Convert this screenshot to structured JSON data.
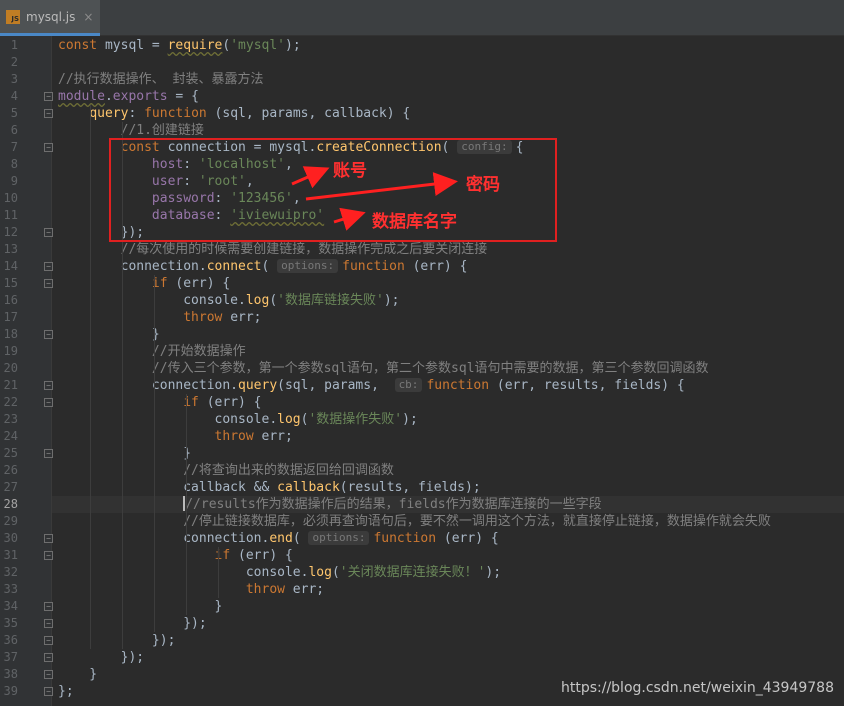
{
  "tab": {
    "icon_label": "JS",
    "title": "mysql.js",
    "close": "×"
  },
  "lines": [
    {
      "n": "1",
      "html": "<span class=\"kw\">const</span> mysql = <span class=\"fn wavy\">require</span>(<span class=\"str\">'mysql'</span>);"
    },
    {
      "n": "2",
      "html": ""
    },
    {
      "n": "3",
      "html": "<span class=\"cmt\">//执行数据操作、 封装、暴露方法</span>"
    },
    {
      "n": "4",
      "html": "<span class=\"prop wavy\">module</span>.<span class=\"prop\">exports</span> = {"
    },
    {
      "n": "5",
      "html": "    <span class=\"fn\">query</span>: <span class=\"kw\">function</span> (sql, params, callback) {"
    },
    {
      "n": "6",
      "html": "        <span class=\"cmt\">//1.创建链接</span>"
    },
    {
      "n": "7",
      "html": "        <span class=\"kw\">const</span> connection = mysql.<span class=\"fn\">createConnection</span>( <span class=\"hint\">config:</span>{"
    },
    {
      "n": "8",
      "html": "            <span class=\"prop\">host</span>: <span class=\"str\">'localhost'</span>,"
    },
    {
      "n": "9",
      "html": "            <span class=\"prop\">user</span>: <span class=\"str\">'root'</span>,"
    },
    {
      "n": "10",
      "html": "            <span class=\"prop\">password</span>: <span class=\"str\">'123456'</span>,"
    },
    {
      "n": "11",
      "html": "            <span class=\"prop\">database</span>: <span class=\"str wavy\">'iviewuipro'</span>"
    },
    {
      "n": "12",
      "html": "        });"
    },
    {
      "n": "13",
      "html": "        <span class=\"cmt\">//每次使用的时候需要创建链接，数据操作完成之后要关闭连接</span>"
    },
    {
      "n": "14",
      "html": "        connection.<span class=\"fn\">connect</span>( <span class=\"hint\">options:</span><span class=\"kw\">function</span> (err) {"
    },
    {
      "n": "15",
      "html": "            <span class=\"kw\">if</span> (err) {"
    },
    {
      "n": "16",
      "html": "                console.<span class=\"fn\">log</span>(<span class=\"str\">'数据库链接失败'</span>);"
    },
    {
      "n": "17",
      "html": "                <span class=\"kw\">throw</span> err;"
    },
    {
      "n": "18",
      "html": "            }"
    },
    {
      "n": "19",
      "html": "            <span class=\"cmt\">//开始数据操作</span>"
    },
    {
      "n": "20",
      "html": "            <span class=\"cmt\">//传入三个参数，第一个参数sql语句，第二个参数sql语句中需要的数据，第三个参数回调函数</span>"
    },
    {
      "n": "21",
      "html": "            connection.<span class=\"fn\">query</span>(sql, params,  <span class=\"hint\">cb:</span><span class=\"kw\">function</span> (err, results, fields) {"
    },
    {
      "n": "22",
      "html": "                <span class=\"kw\">if</span> (err) {"
    },
    {
      "n": "23",
      "html": "                    console.<span class=\"fn\">log</span>(<span class=\"str\">'数据操作失败'</span>);"
    },
    {
      "n": "24",
      "html": "                    <span class=\"kw\">throw</span> err;"
    },
    {
      "n": "25",
      "html": "                }"
    },
    {
      "n": "26",
      "html": "                <span class=\"cmt\">//将查询出来的数据返回给回调函数</span>"
    },
    {
      "n": "27",
      "html": "                callback &amp;&amp; <span class=\"fn\">callback</span>(results, fields);"
    },
    {
      "n": "28",
      "html": "                <span class=\"caret\"></span><span class=\"cmt\">//results作为数据操作后的结果，fields作为数据库连接的一些字段</span>"
    },
    {
      "n": "29",
      "html": "                <span class=\"cmt\">//停止链接数据库，必须再查询语句后，要不然一调用这个方法，就直接停止链接，数据操作就会失败</span>"
    },
    {
      "n": "30",
      "html": "                connection.<span class=\"fn\">end</span>( <span class=\"hint\">options:</span><span class=\"kw\">function</span> (err) {"
    },
    {
      "n": "31",
      "html": "                    <span class=\"kw\">if</span> (err) {"
    },
    {
      "n": "32",
      "html": "                        console.<span class=\"fn\">log</span>(<span class=\"str\">'关闭数据库连接失败！'</span>);"
    },
    {
      "n": "33",
      "html": "                        <span class=\"kw\">throw</span> err;"
    },
    {
      "n": "34",
      "html": "                    }"
    },
    {
      "n": "35",
      "html": "                });"
    },
    {
      "n": "36",
      "html": "            });"
    },
    {
      "n": "37",
      "html": "        });"
    },
    {
      "n": "38",
      "html": "    }"
    },
    {
      "n": "39",
      "html": "};"
    }
  ],
  "active_line": "28",
  "fold_lines": [
    "4",
    "5",
    "7",
    "12",
    "14",
    "15",
    "18",
    "21",
    "22",
    "25",
    "30",
    "31",
    "34",
    "35",
    "36",
    "37",
    "38",
    "39"
  ],
  "annotations": {
    "account": "账号",
    "password": "密码",
    "db_name": "数据库名字"
  },
  "watermark": "https://blog.csdn.net/weixin_43949788",
  "colors": {
    "annotation_red": "#e02020",
    "accent_tab": "#4a88c7"
  }
}
